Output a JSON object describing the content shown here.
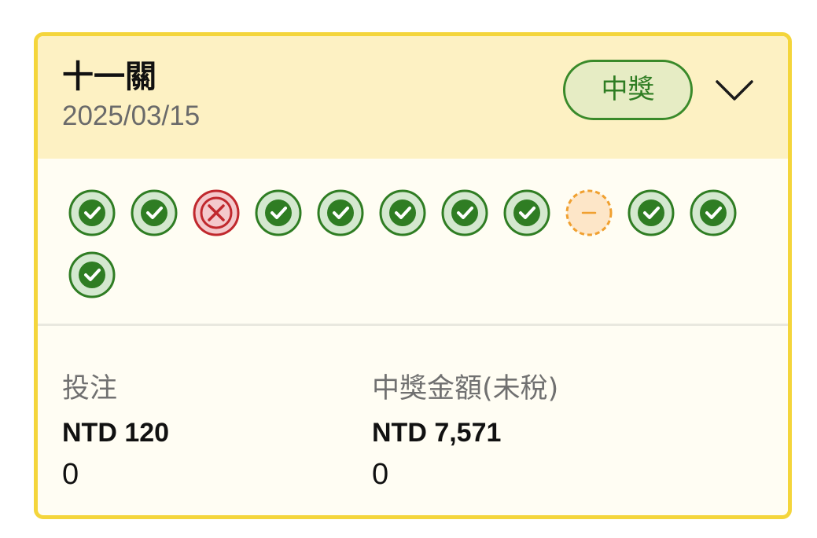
{
  "card": {
    "title": "十一關",
    "date": "2025/03/15",
    "status": "中獎",
    "results": [
      "correct",
      "correct",
      "wrong",
      "correct",
      "correct",
      "correct",
      "correct",
      "correct",
      "void",
      "correct",
      "correct",
      "correct"
    ],
    "stake_label": "投注",
    "stake_amount": "NTD 120",
    "stake_extra": "0",
    "prize_label": "中獎金額(未稅)",
    "prize_amount": "NTD 7,571",
    "prize_extra": "0"
  },
  "icons": {
    "correct": "check-circle-icon",
    "wrong": "cross-circle-icon",
    "void": "minus-dashed-circle-icon",
    "expand": "chevron-down-icon"
  },
  "colors": {
    "border": "#f4d53b",
    "header_bg": "#fdf1c3",
    "body_bg": "#fffdf3",
    "win_green": "#2f7d23",
    "badge_bg": "#e6ecc4",
    "wrong_red": "#c0282d",
    "void_orange": "#f0a030"
  }
}
